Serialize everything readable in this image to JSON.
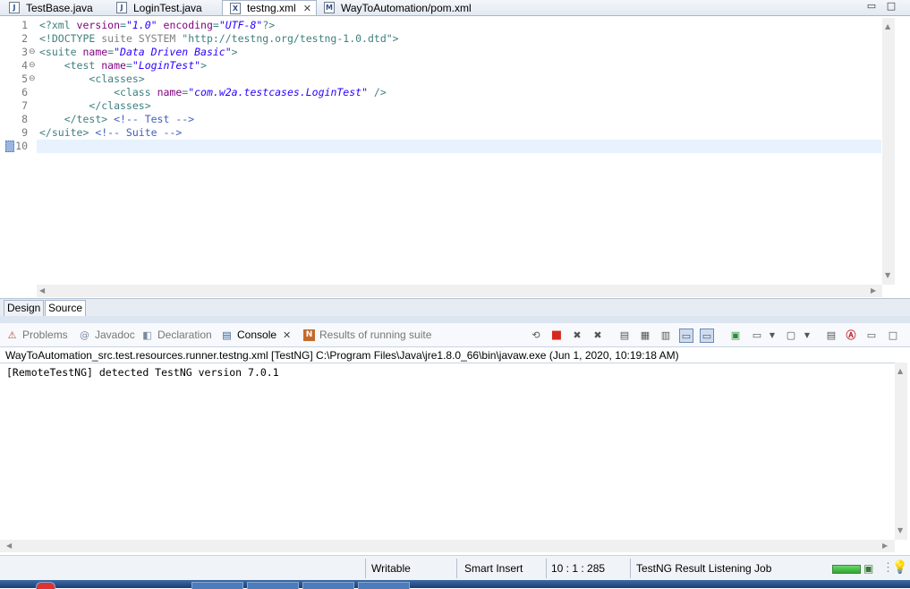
{
  "editor_tabs": [
    {
      "label": "TestBase.java",
      "icon": "java-file-icon",
      "glyph": "J"
    },
    {
      "label": "LoginTest.java",
      "icon": "java-file-icon",
      "glyph": "J"
    },
    {
      "label": "testng.xml",
      "icon": "xml-file-icon",
      "glyph": "X",
      "active": true,
      "close": "✕"
    },
    {
      "label": "WayToAutomation/pom.xml",
      "icon": "maven-file-icon",
      "glyph": "M"
    }
  ],
  "window_controls": {
    "minimize": "▭",
    "maximize": "□"
  },
  "editor": {
    "line_numbers": [
      "1",
      "2",
      "3",
      "4",
      "5",
      "6",
      "7",
      "8",
      "9",
      "10"
    ],
    "fold_markers": {
      "3": "⊖",
      "4": "⊖",
      "5": "⊖"
    },
    "lines": {
      "l1": {
        "p1": "<?xml ",
        "a1": "version",
        "p2": "=",
        "v1": "\"1.0\"",
        "p3": " ",
        "a2": "encoding",
        "p4": "=",
        "v2": "\"UTF-8\"",
        "p5": "?>"
      },
      "l2": {
        "p1": "<!DOCTYPE ",
        "d1": "suite SYSTEM ",
        "s1": "\"http://testng.org/testng-1.0.dtd\"",
        "p2": ">"
      },
      "l3": {
        "p1": "<suite ",
        "a1": "name",
        "p2": "=",
        "v1": "\"Data Driven Basic\"",
        "p3": ">"
      },
      "l4": {
        "indent": "    ",
        "p1": "<test ",
        "a1": "name",
        "p2": "=",
        "v1": "\"LoginTest\"",
        "p3": ">"
      },
      "l5": {
        "indent": "        ",
        "p1": "<classes>"
      },
      "l6": {
        "indent": "            ",
        "p1": "<class ",
        "a1": "name",
        "p2": "=",
        "v1": "\"com.w2a.testcases.LoginTest\"",
        "p3": " />"
      },
      "l7": {
        "indent": "        ",
        "p1": "</classes>"
      },
      "l8": {
        "indent": "    ",
        "p1": "</test> ",
        "c1": "<!-- Test -->"
      },
      "l9": {
        "p1": "</suite> ",
        "c1": "<!-- Suite -->"
      },
      "l10": {
        "p1": ""
      }
    }
  },
  "design_source_tabs": [
    "Design",
    "Source"
  ],
  "view_tabs": [
    {
      "label": "Problems",
      "icon": "problems-icon",
      "glyph": "⚠"
    },
    {
      "label": "Javadoc",
      "icon": "javadoc-icon",
      "glyph": "@"
    },
    {
      "label": "Declaration",
      "icon": "declaration-icon",
      "glyph": "◧"
    },
    {
      "label": "Console",
      "icon": "console-icon",
      "glyph": "▤",
      "active": true,
      "close": "✕"
    },
    {
      "label": "Results of running suite",
      "icon": "testng-icon",
      "glyph": "N"
    }
  ],
  "console": {
    "description": "WayToAutomation_src.test.resources.runner.testng.xml [TestNG] C:\\Program Files\\Java\\jre1.8.0_66\\bin\\javaw.exe (Jun 1, 2020, 10:19:18 AM)",
    "output": "[RemoteTestNG] detected TestNG version 7.0.1"
  },
  "status_bar": {
    "writable": "Writable",
    "insert_mode": "Smart Insert",
    "position": "10 : 1 : 285",
    "job": "TestNG Result Listening Job"
  },
  "colors": {
    "tag": "#3f7f7f",
    "attribute": "#7f007f",
    "value": "#2a00ff",
    "comment": "#3f5fbf",
    "current_line": "#e8f2fe",
    "terminate_red": "#d42a1f"
  }
}
